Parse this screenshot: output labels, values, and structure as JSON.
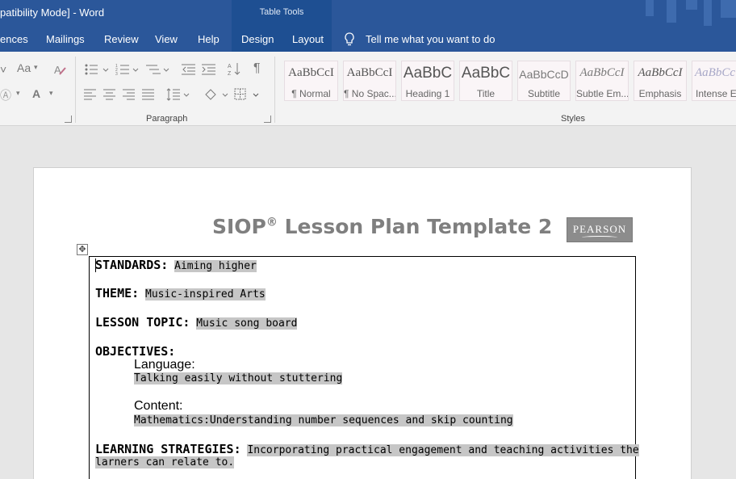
{
  "window": {
    "title": "patibility Mode]  -  Word",
    "contextual_tab_group": "Table Tools"
  },
  "tabs": {
    "items": [
      "ences",
      "Mailings",
      "Review",
      "View",
      "Help",
      "Design",
      "Layout"
    ],
    "tell_me": "Tell me what you want to do"
  },
  "ribbon": {
    "paragraph_group": "Paragraph",
    "styles_group": "Styles",
    "font_case": "Aa",
    "font_color": "A",
    "pilcrow": "¶",
    "styles": [
      {
        "preview": "AaBbCcI",
        "name": "¶ Normal"
      },
      {
        "preview": "AaBbCcI",
        "name": "¶ No Spac..."
      },
      {
        "preview": "AaBbC",
        "name": "Heading 1"
      },
      {
        "preview": "AaBbC",
        "name": "Title"
      },
      {
        "preview": "AaBbCcD",
        "name": "Subtitle"
      },
      {
        "preview": "AaBbCcI",
        "name": "Subtle Em..."
      },
      {
        "preview": "AaBbCcI",
        "name": "Emphasis"
      },
      {
        "preview": "AaBbCc",
        "name": "Intense E..."
      }
    ]
  },
  "document": {
    "title_main": "SIOP",
    "title_reg": "®",
    "title_rest": " Lesson Plan Template 2",
    "logo_text": "PEARSON",
    "standards": {
      "label": "STANDARDS:",
      "value": "Aiming higher"
    },
    "theme": {
      "label": "THEME:",
      "value": "Music-inspired Arts"
    },
    "lesson_topic": {
      "label": "LESSON TOPIC:",
      "value": "Music song board"
    },
    "objectives": {
      "label": "OBJECTIVES:",
      "language_label": "Language:",
      "language_value": "Talking easily without stuttering",
      "content_label": "Content:",
      "content_value": "Mathematics:Understanding number sequences and skip counting"
    },
    "learning_strategies": {
      "label": "LEARNING STRATEGIES:",
      "value_line1": "Incorporating practical engagement and teaching activities the",
      "value_line2": "larners can relate to. "
    }
  }
}
